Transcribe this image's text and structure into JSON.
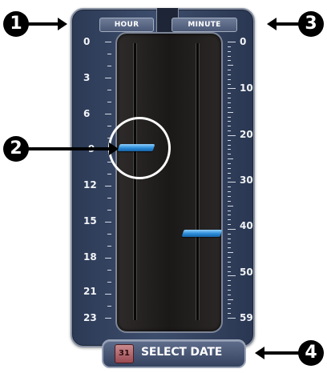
{
  "hour_header": "HOUR",
  "minute_header": "MINUTE",
  "hour_scale": [
    "0",
    "3",
    "6",
    "9",
    "12",
    "15",
    "18",
    "21",
    "23"
  ],
  "minute_scale": [
    "0",
    "10",
    "20",
    "30",
    "40",
    "50",
    "59"
  ],
  "hour_slider": {
    "value": 9
  },
  "minute_slider": {
    "value": 42
  },
  "select_date": {
    "label": "SELECT DATE",
    "icon": "calendar-icon",
    "icon_text": "31"
  },
  "callouts": [
    "1",
    "2",
    "3",
    "4"
  ],
  "colors": {
    "panel": "#3a4a68",
    "slider": "#2b8bd6",
    "track": "#1b1918"
  }
}
